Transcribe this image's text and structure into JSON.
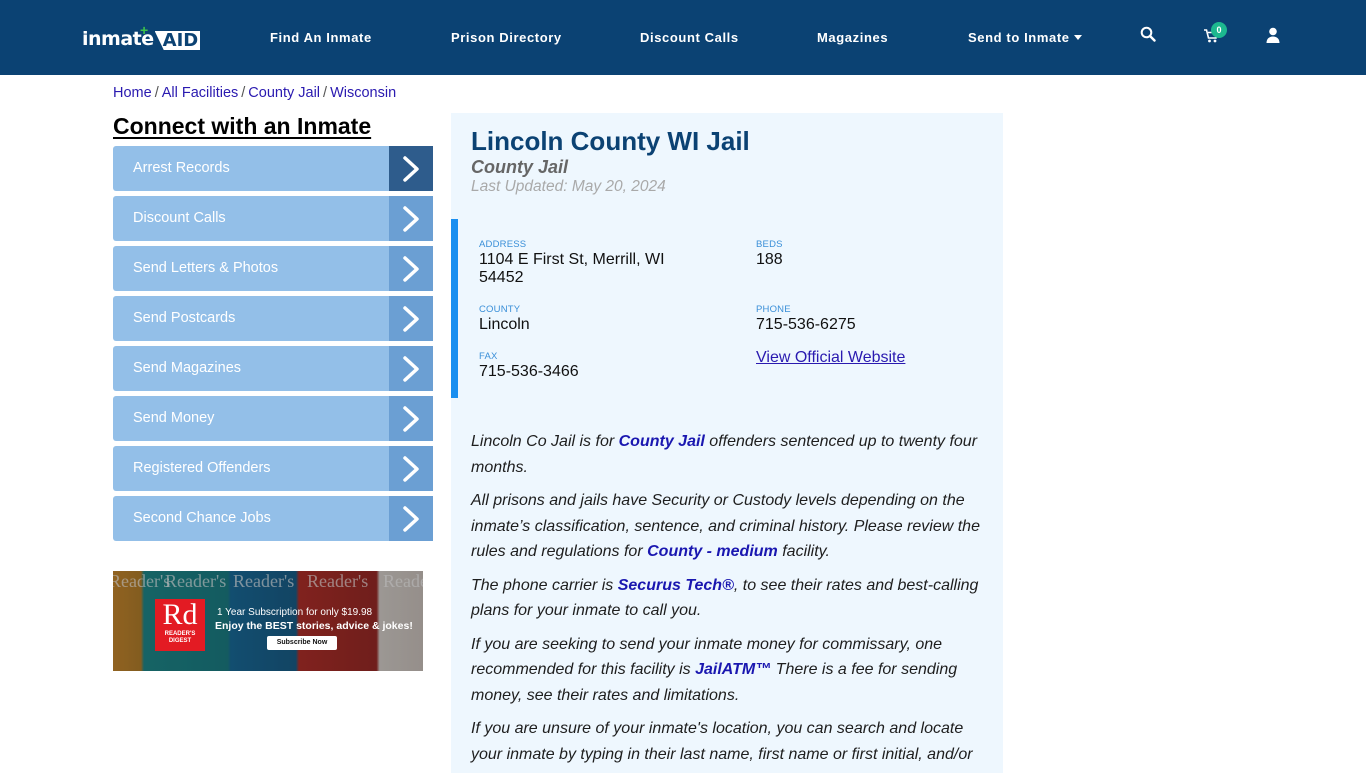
{
  "header": {
    "logo": {
      "text": "inmate",
      "accent": "AID",
      "plus": "+"
    },
    "nav": [
      {
        "label": "Find An Inmate"
      },
      {
        "label": "Prison Directory"
      },
      {
        "label": "Discount Calls"
      },
      {
        "label": "Magazines"
      },
      {
        "label": "Send to Inmate",
        "has_dropdown": true
      }
    ],
    "icons": {
      "search": "search-icon",
      "cart": "cart-icon",
      "user": "user-icon"
    },
    "cart_count": "0",
    "colors": {
      "bar": "#0b4273",
      "badge": "#1db88f"
    }
  },
  "breadcrumb": {
    "items": [
      "Home",
      "All Facilities",
      "County Jail",
      "Wisconsin"
    ],
    "separator": "/"
  },
  "sidebar": {
    "title": "Connect with an Inmate",
    "items": [
      {
        "label": "Arrest Records",
        "active": true
      },
      {
        "label": "Discount Calls"
      },
      {
        "label": "Send Letters & Photos"
      },
      {
        "label": "Send Postcards"
      },
      {
        "label": "Send Magazines"
      },
      {
        "label": "Send Money"
      },
      {
        "label": "Registered Offenders"
      },
      {
        "label": "Second Chance Jobs"
      }
    ],
    "ad": {
      "brand_big": "Rd",
      "brand_small_1": "READER'S",
      "brand_small_2": "DIGEST",
      "cover_title": "Reader's",
      "line1": "1 Year Subscription for only $19.98",
      "line2": "Enjoy the BEST stories, advice & jokes!",
      "button": "Subscribe Now"
    }
  },
  "facility": {
    "title": "Lincoln County WI Jail",
    "type": "County Jail",
    "last_updated": "Last Updated: May 20, 2024",
    "fields": {
      "address_label": "ADDRESS",
      "address_line1": "1104 E First St, Merrill, WI",
      "address_line2": "54452",
      "beds_label": "BEDS",
      "beds": "188",
      "county_label": "COUNTY",
      "county": "Lincoln",
      "phone_label": "PHONE",
      "phone": "715-536-6275",
      "fax_label": "FAX",
      "fax": "715-536-3466",
      "website_link": "View Official Website"
    },
    "paragraphs": {
      "p1": {
        "a": "Lincoln Co Jail is for ",
        "link": "County Jail",
        "b": " offenders sentenced up to twenty four months."
      },
      "p2": {
        "a": "All prisons and jails have Security or Custody levels depending on the inmate’s classification, sentence, and criminal history. Please review the rules and regulations for ",
        "link": "County - medium",
        "b": " facility."
      },
      "p3": {
        "a": "The phone carrier is ",
        "link": "Securus Tech®",
        "b": ", to see their rates and best-calling plans for your inmate to call you."
      },
      "p4": {
        "a": "If you are seeking to send your inmate money for commissary, one recommended for this facility is ",
        "link": "JailATM™",
        "b": " There is a fee for sending money, see their rates and limitations."
      },
      "p5": {
        "a": "If you are unsure of your inmate's location, you can search and locate your inmate by typing in their last name, first name or first initial, and/or"
      }
    }
  }
}
